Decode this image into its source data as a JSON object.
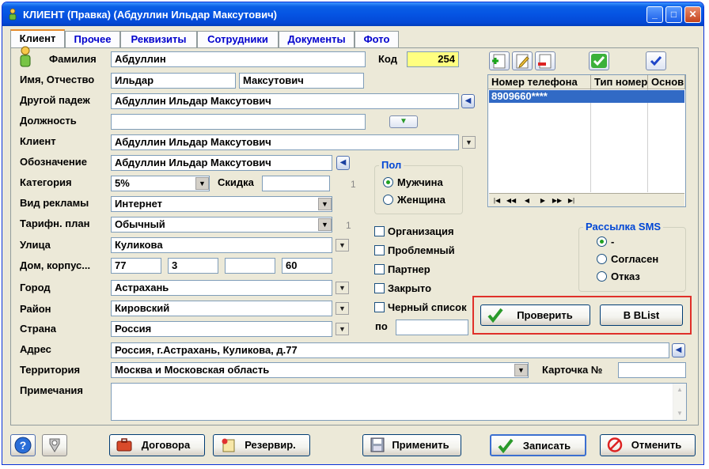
{
  "window": {
    "title": "КЛИЕНТ (Правка)  (Абдуллин Ильдар Максутович)"
  },
  "tabs": [
    "Клиент",
    "Прочее",
    "Реквизиты",
    "Сотрудники",
    "Документы",
    "Фото"
  ],
  "form": {
    "surname_label": "Фамилия",
    "surname": "Абдуллин",
    "code_label": "Код",
    "code": "254",
    "name_label": "Имя, Отчество",
    "first_name": "Ильдар",
    "patronymic": "Максутович",
    "case_label": "Другой падеж",
    "case_value": "Абдуллин Ильдар Максутович",
    "position_label": "Должность",
    "position": "",
    "client_label": "Клиент",
    "client": "Абдуллин Ильдар Максутович",
    "designation_label": "Обозначение",
    "designation": "Абдуллин Ильдар Максутович",
    "category_label": "Категория",
    "category": "5%",
    "discount_label": "Скидка",
    "discount": "",
    "discount_num": "1",
    "ad_label": "Вид рекламы",
    "ad": "Интернет",
    "tariff_label": "Тарифн. план",
    "tariff": "Обычный",
    "tariff_num": "1",
    "street_label": "Улица",
    "street": "Куликова",
    "house_label": "Дом, корпус...",
    "house": "77",
    "building": "3",
    "entrance": "",
    "apartment": "60",
    "city_label": "Город",
    "city": "Астрахань",
    "district_label": "Район",
    "district": "Кировский",
    "country_label": "Страна",
    "country": "Россия",
    "address_label": "Адрес",
    "address": "Россия, г.Астрахань, Куликова, д.77",
    "territory_label": "Территория",
    "territory": "Москва и Московская область",
    "card_label": "Карточка №",
    "card": "",
    "notes_label": "Примечания",
    "notes": ""
  },
  "gender": {
    "title": "Пол",
    "male": "Мужчина",
    "female": "Женщина",
    "selected": "male"
  },
  "checks": {
    "org": "Организация",
    "problem": "Проблемный",
    "partner": "Партнер",
    "closed": "Закрыто",
    "blacklist": "Черный список",
    "by_label": "по",
    "by_value": ""
  },
  "phones": {
    "columns": [
      "Номер телефона",
      "Тип номера",
      "Основной"
    ],
    "rows": [
      [
        "8909660****",
        "",
        ""
      ]
    ]
  },
  "sms": {
    "title": "Рассылка SMS",
    "opt1": "-",
    "opt2": "Согласен",
    "opt3": "Отказ",
    "selected": "opt1"
  },
  "actions": {
    "check": "Проверить",
    "blist": "В BList"
  },
  "bottom": {
    "contracts": "Договора",
    "reserve": "Резервир.",
    "apply": "Применить",
    "save": "Записать",
    "cancel": "Отменить"
  },
  "colors": {
    "title_bar": "#0554e3",
    "highlight_box": "#e0302a",
    "code_bg": "#ffff80",
    "selected_row": "#316ac5"
  }
}
